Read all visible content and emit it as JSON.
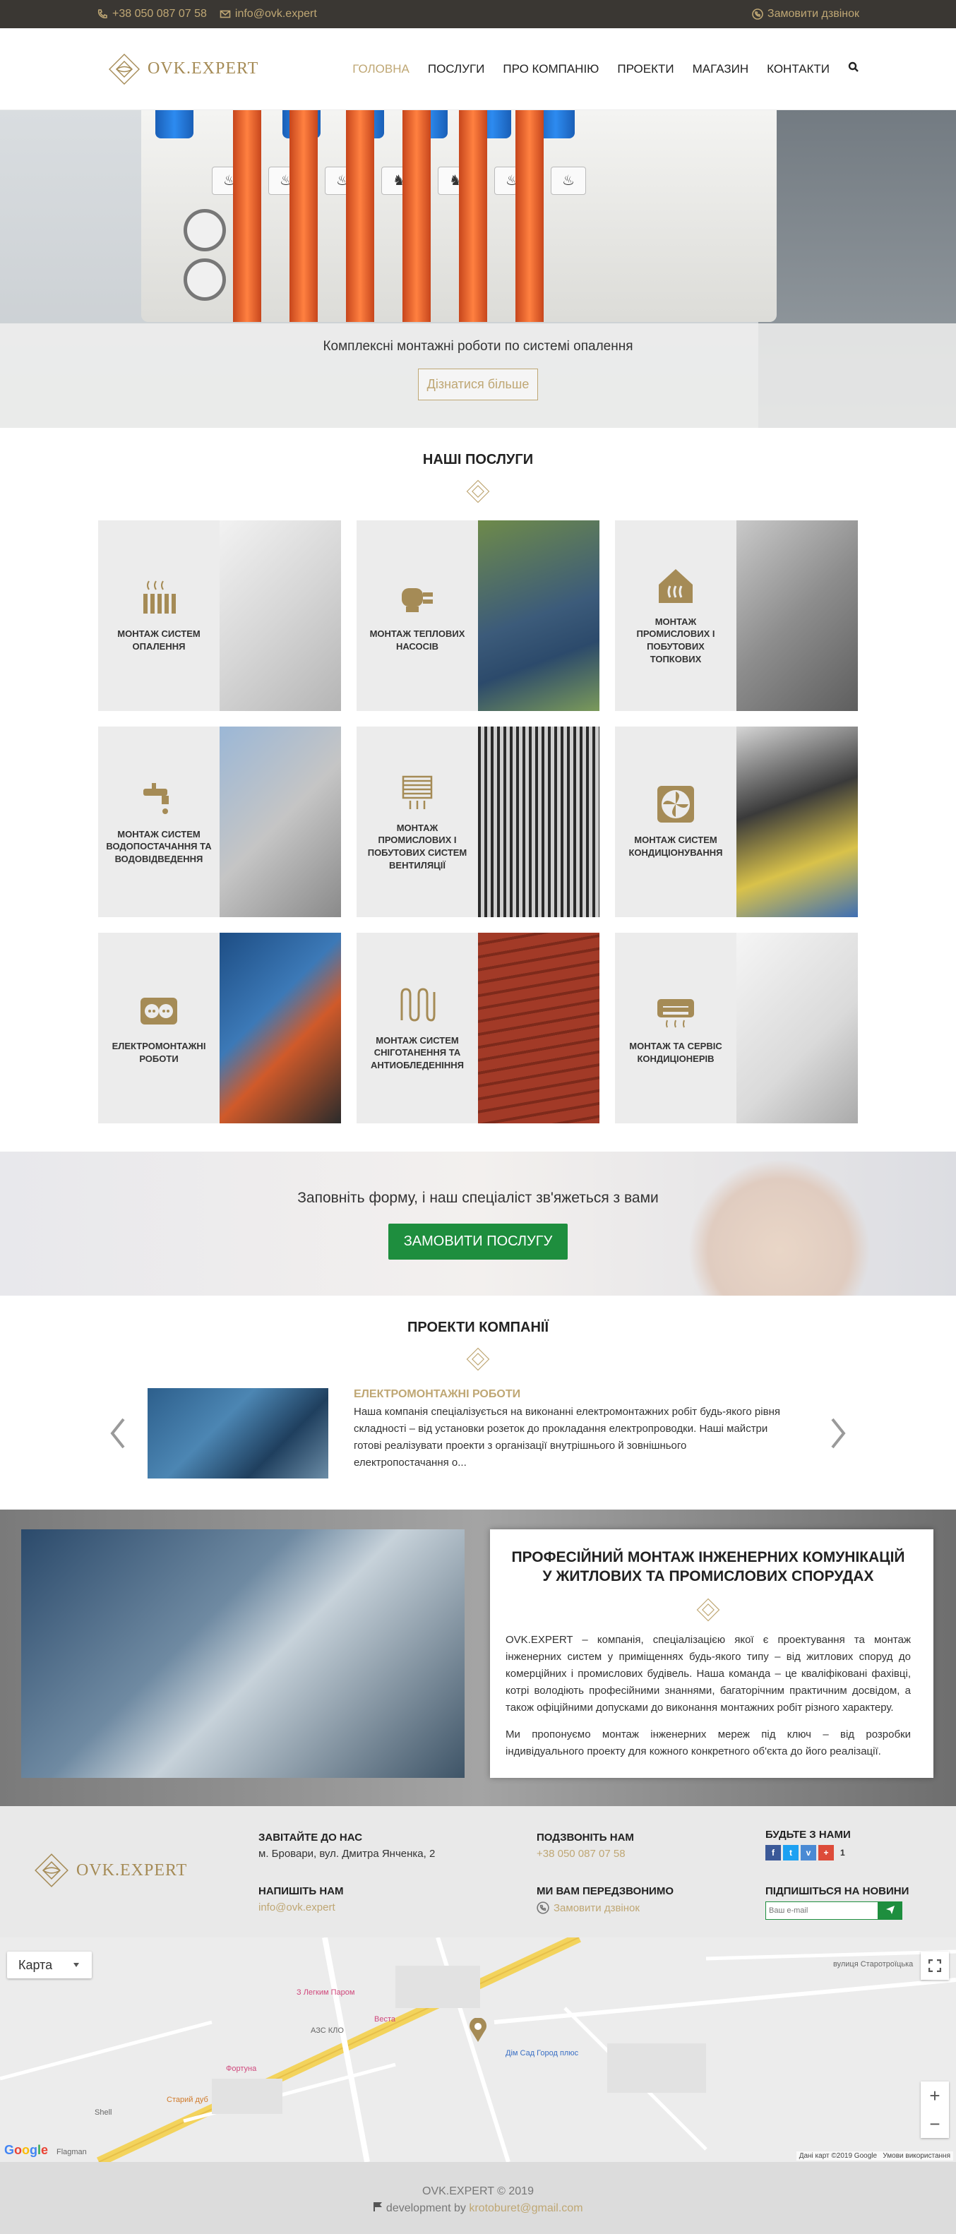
{
  "topbar": {
    "phone": "+38 050 087 07 58",
    "email": "info@ovk.expert",
    "callback": "Замовити дзвінок"
  },
  "header": {
    "logo_text": "OVK.EXPERT",
    "nav": [
      "ГОЛОВНА",
      "ПОСЛУГИ",
      "ПРО КОМПАНІЮ",
      "ПРОЕКТИ",
      "МАГАЗИН",
      "КОНТАКТИ"
    ],
    "active_index": 0
  },
  "hero": {
    "caption": "Комплексні монтажні роботи по системі опалення",
    "button": "Дізнатися більше"
  },
  "services": {
    "title": "НАШІ ПОСЛУГИ",
    "items": [
      {
        "label": "МОНТАЖ СИСТЕМ ОПАЛЕННЯ",
        "icon": "radiator-icon"
      },
      {
        "label": "МОНТАЖ ТЕПЛОВИХ НАСОСІВ",
        "icon": "heat-pump-icon"
      },
      {
        "label": "МОНТАЖ ПРОМИСЛОВИХ І ПОБУТОВИХ ТОПКОВИХ",
        "icon": "boiler-house-icon"
      },
      {
        "label": "МОНТАЖ СИСТЕМ ВОДОПОСТАЧАННЯ ТА ВОДОВІДВЕДЕННЯ",
        "icon": "faucet-icon"
      },
      {
        "label": "МОНТАЖ ПРОМИСЛОВИХ І ПОБУТОВИХ СИСТЕМ ВЕНТИЛЯЦІЇ",
        "icon": "ventilation-icon"
      },
      {
        "label": "МОНТАЖ СИСТЕМ КОНДИЦІОНУВАННЯ",
        "icon": "fan-icon"
      },
      {
        "label": "ЕЛЕКТРОМОНТАЖНІ РОБОТИ",
        "icon": "socket-icon"
      },
      {
        "label": "МОНТАЖ СИСТЕМ СНІГОТАНЕННЯ ТА АНТИОБЛЕДЕНІННЯ",
        "icon": "heating-cable-icon"
      },
      {
        "label": "МОНТАЖ ТА СЕРВІС КОНДИЦІОНЕРІВ",
        "icon": "air-conditioner-icon"
      }
    ]
  },
  "cta": {
    "text": "Заповніть форму, і наш спеціаліст зв'яжеться з вами",
    "button": "ЗАМОВИТИ ПОСЛУГУ"
  },
  "projects": {
    "title": "ПРОЕКТИ КОМПАНІЇ",
    "slide_title": "ЕЛЕКТРОМОНТАЖНІ РОБОТИ",
    "slide_text": "Наша компанія спеціалізується на виконанні електромонтажних робіт будь-якого рівня складності – від установки розеток до прокладання електропроводки. Наші майстри готові реалізувати проекти з організації внутрішнього й зовнішнього електропостачання о..."
  },
  "about": {
    "title": "ПРОФЕСІЙНИЙ МОНТАЖ ІНЖЕНЕРНИХ КОМУНІКАЦІЙ У ЖИТЛОВИХ ТА ПРОМИСЛОВИХ СПОРУДАХ",
    "p1": "OVK.EXPERT – компанія, спеціалізацією якої є проектування та монтаж інженерних систем у приміщеннях будь-якого типу – від житлових споруд до комерційних і промислових будівель. Наша команда – це кваліфіковані фахівці, котрі володіють професійними знаннями, багаторічним практичним досвідом, а також офіційними допусками до виконання монтажних робіт різного характеру.",
    "p2": "Ми пропонуємо монтаж інженерних мереж під ключ – від розробки індивідуального проекту для кожного конкретного об'єкта до його реалізації."
  },
  "footer": {
    "visit_title": "ЗАВІТАЙТЕ ДО НАС",
    "address": "м. Бровари, вул. Дмитра Янченка, 2",
    "write_title": "НАПИШІТЬ НАМ",
    "email": "info@ovk.expert",
    "call_title": "ПОДЗВОНІТЬ НАМ",
    "phone": "+38 050 087 07 58",
    "recall_title": "МИ ВАМ ПЕРЕДЗВОНИМО",
    "recall_link": "Замовити дзвінок",
    "social_title": "БУДЬТЕ З НАМИ",
    "social_count": "1",
    "subscribe_title": "ПІДПИШІТЬСЯ НА НОВИНИ",
    "subscribe_placeholder": "Ваш e-mail"
  },
  "map": {
    "type_button": "Карта",
    "attribution": "Дані карт ©2019 Google",
    "terms": "Умови використання",
    "labels": [
      "З Легким Паром",
      "Веста",
      "АЗС КЛО",
      "Фортуна",
      "Старий дуб",
      "Shell",
      "Flagman",
      "Дім Сад Город плюс",
      "вулиця Старотроїцька"
    ]
  },
  "bottom": {
    "copyright": "OVK.EXPERT © 2019",
    "dev_prefix": "development by",
    "dev_email": "krotoburet@gmail.com"
  },
  "colors": {
    "gold": "#bfa774",
    "topbar": "#3a3733",
    "green": "#1e8e3e"
  }
}
